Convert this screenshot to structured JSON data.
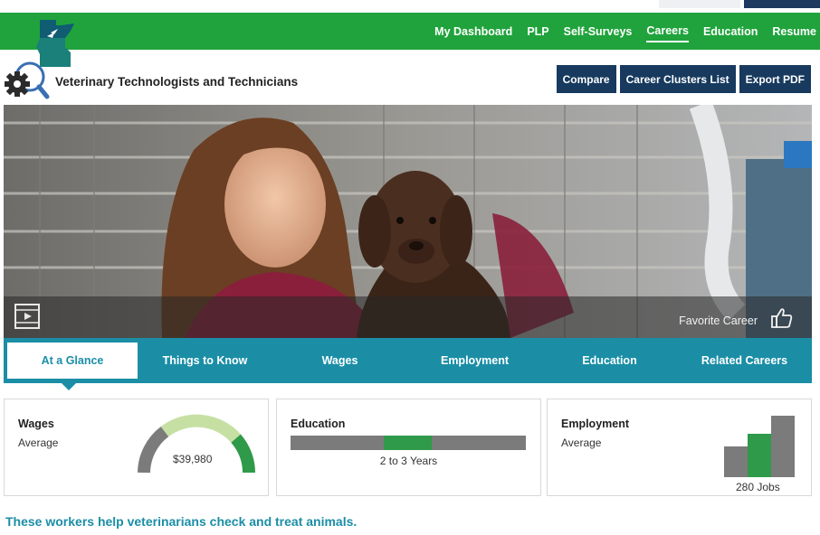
{
  "nav": {
    "links": [
      "My Dashboard",
      "PLP",
      "Self-Surveys",
      "Careers",
      "Education",
      "Resume"
    ],
    "active_index": 3
  },
  "career": {
    "title": "Veterinary Technologists and Technicians",
    "buttons": [
      "Compare",
      "Career Clusters List",
      "Export PDF"
    ]
  },
  "hero": {
    "favorite_label": "Favorite Career"
  },
  "tabs": {
    "items": [
      "At a Glance",
      "Things to Know",
      "Wages",
      "Employment",
      "Education",
      "Related Careers"
    ],
    "active_index": 0
  },
  "cards": {
    "wages": {
      "title": "Wages",
      "subtitle": "Average",
      "value": "$39,980"
    },
    "education": {
      "title": "Education",
      "value": "2 to 3 Years"
    },
    "employment": {
      "title": "Employment",
      "subtitle": "Average",
      "value": "280 Jobs"
    }
  },
  "summary": "These workers help veterinarians check and treat animals.",
  "colors": {
    "nav_green": "#20a33c",
    "button_navy": "#173a5e",
    "tab_teal": "#1b8ea6",
    "accent_green": "#2f9a49",
    "gauge_light": "#c6e0a4",
    "neutral_gray": "#7b7b7b"
  },
  "icons": [
    "minnesota-logo-icon",
    "career-search-gear-icon",
    "video-icon",
    "thumbs-up-icon"
  ]
}
